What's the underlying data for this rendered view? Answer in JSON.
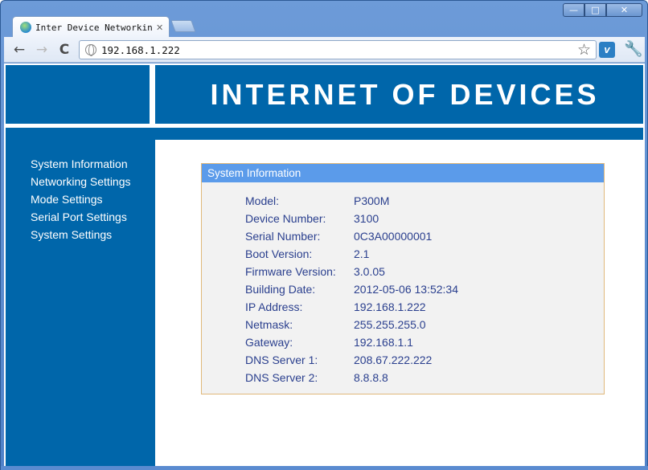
{
  "window": {
    "controls": {
      "minimize": "—",
      "maximize": "□",
      "close": "✕"
    }
  },
  "tab": {
    "title": "Inter Device Networking",
    "close": "✕"
  },
  "toolbar": {
    "back_icon": "←",
    "forward_icon": "→",
    "reload_icon": "C",
    "url": "192.168.1.222",
    "star_icon": "☆",
    "extension_icon": "v",
    "wrench_icon": "🔧"
  },
  "header": {
    "title": "INTERNET OF DEVICES"
  },
  "sidebar": {
    "items": [
      {
        "label": "System Information"
      },
      {
        "label": "Networking Settings"
      },
      {
        "label": "Mode Settings"
      },
      {
        "label": "Serial Port Settings"
      },
      {
        "label": "System Settings"
      }
    ]
  },
  "panel": {
    "title": "System Information",
    "rows": [
      {
        "label": "Model:",
        "value": "P300M"
      },
      {
        "label": "Device Number:",
        "value": "3100"
      },
      {
        "label": "Serial Number:",
        "value": "0C3A00000001"
      },
      {
        "label": "Boot Version:",
        "value": "2.1"
      },
      {
        "label": "Firmware Version:",
        "value": "3.0.05"
      },
      {
        "label": "Building Date:",
        "value": "2012-05-06 13:52:34"
      },
      {
        "label": "IP Address:",
        "value": "192.168.1.222"
      },
      {
        "label": "Netmask:",
        "value": "255.255.255.0"
      },
      {
        "label": "Gateway:",
        "value": "192.168.1.1"
      },
      {
        "label": "DNS Server 1:",
        "value": "208.67.222.222"
      },
      {
        "label": "DNS Server 2:",
        "value": "8.8.8.8"
      }
    ]
  },
  "colors": {
    "brand_blue": "#0066aa",
    "panel_header": "#5b9bea",
    "panel_border": "#e0b87a",
    "info_text": "#2a3f8e"
  }
}
